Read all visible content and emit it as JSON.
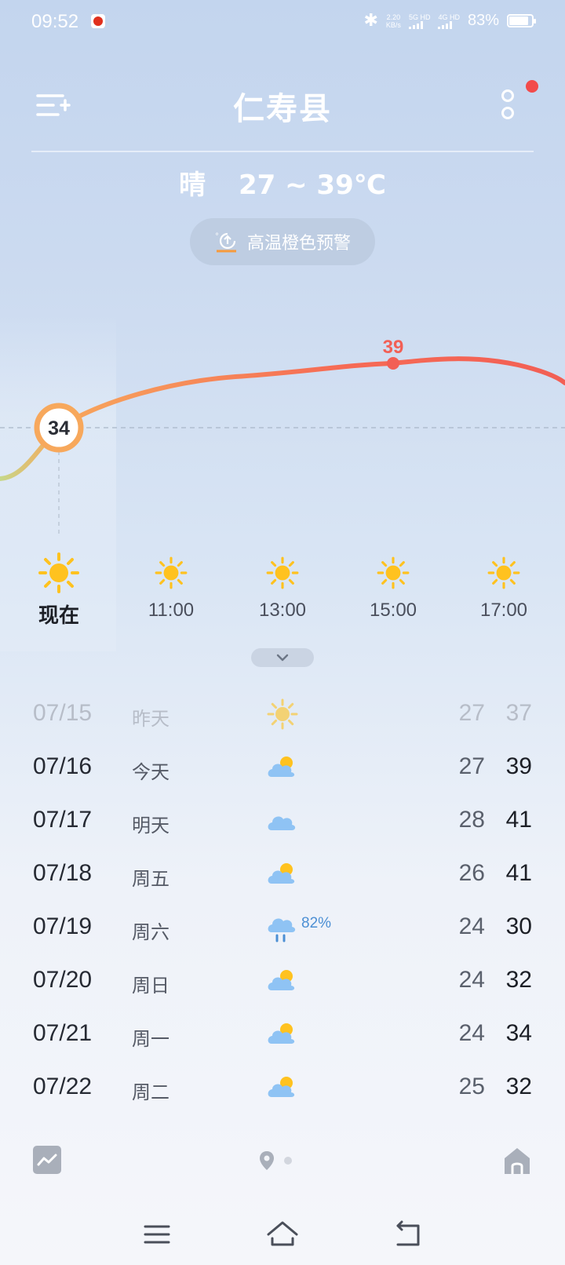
{
  "status_bar": {
    "time": "09:52",
    "net_speed_value": "2.20",
    "net_speed_unit": "KB/s",
    "sim1": "5G HD",
    "sim2": "4G HD",
    "battery": "83%"
  },
  "header": {
    "city": "仁寿县",
    "menu_icon": "menu-add-icon",
    "more_icon": "more-vertical-icon"
  },
  "today": {
    "condition": "晴",
    "range": "27 ~ 39℃"
  },
  "alert": {
    "label": "高温橙色预警",
    "icon": "heat-warning-icon"
  },
  "chart_data": {
    "type": "line",
    "current_temp": "34",
    "peak_label": "39",
    "x": [
      "现在",
      "11:00",
      "13:00",
      "15:00",
      "17:00"
    ],
    "values": [
      34,
      37,
      38,
      39,
      38
    ],
    "series": [
      {
        "values": [
          34,
          37,
          38,
          39,
          38
        ]
      }
    ]
  },
  "hourly": [
    {
      "label": "现在",
      "icon": "sunny-icon"
    },
    {
      "label": "11:00",
      "icon": "sunny-icon"
    },
    {
      "label": "13:00",
      "icon": "sunny-icon"
    },
    {
      "label": "15:00",
      "icon": "sunny-icon"
    },
    {
      "label": "17:00",
      "icon": "sunny-icon"
    }
  ],
  "daily": [
    {
      "date": "07/15",
      "name": "昨天",
      "icon": "sunny-icon",
      "prob": "",
      "low": "27",
      "high": "37"
    },
    {
      "date": "07/16",
      "name": "今天",
      "icon": "partly-cloudy-icon",
      "prob": "",
      "low": "27",
      "high": "39"
    },
    {
      "date": "07/17",
      "name": "明天",
      "icon": "cloudy-icon",
      "prob": "",
      "low": "28",
      "high": "41"
    },
    {
      "date": "07/18",
      "name": "周五",
      "icon": "partly-cloudy-icon",
      "prob": "",
      "low": "26",
      "high": "41"
    },
    {
      "date": "07/19",
      "name": "周六",
      "icon": "rain-icon",
      "prob": "82%",
      "low": "24",
      "high": "30"
    },
    {
      "date": "07/20",
      "name": "周日",
      "icon": "partly-cloudy-icon",
      "prob": "",
      "low": "24",
      "high": "32"
    },
    {
      "date": "07/21",
      "name": "周一",
      "icon": "partly-cloudy-icon",
      "prob": "",
      "low": "24",
      "high": "34"
    },
    {
      "date": "07/22",
      "name": "周二",
      "icon": "partly-cloudy-icon",
      "prob": "",
      "low": "25",
      "high": "32"
    }
  ],
  "colors": {
    "curve_start": "#c6d88a",
    "curve_mid": "#f7a85c",
    "curve_end": "#f25f55",
    "sun": "#ffc21f",
    "cloud": "#8fc3f4",
    "rain_prob": "#4c8fd4"
  }
}
